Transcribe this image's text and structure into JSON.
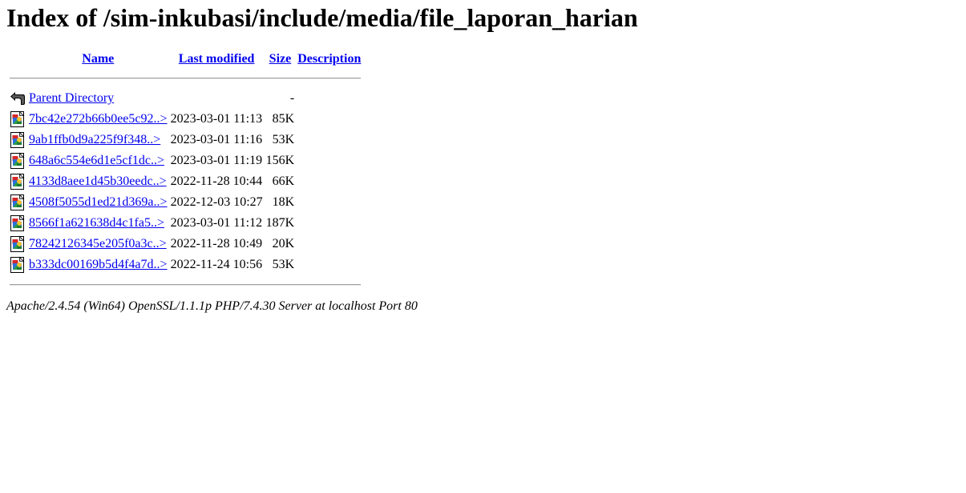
{
  "page": {
    "heading": "Index of /sim-inkubasi/include/media/file_laporan_harian"
  },
  "table": {
    "columns": {
      "name": "Name",
      "modified": "Last modified",
      "size": "Size",
      "description": "Description"
    },
    "parent": {
      "icon": "back-arrow-icon",
      "label": "Parent Directory",
      "size": "-"
    },
    "rows": [
      {
        "icon": "image-file-icon",
        "name": "7bc42e272b66b0ee5c92..>",
        "modified": "2023-03-01 11:13",
        "size": "85K",
        "description": ""
      },
      {
        "icon": "image-file-icon",
        "name": "9ab1ffb0d9a225f9f348..>",
        "modified": "2023-03-01 11:16",
        "size": "53K",
        "description": ""
      },
      {
        "icon": "image-file-icon",
        "name": "648a6c554e6d1e5cf1dc..>",
        "modified": "2023-03-01 11:19",
        "size": "156K",
        "description": ""
      },
      {
        "icon": "image-file-icon",
        "name": "4133d8aee1d45b30eedc..>",
        "modified": "2022-11-28 10:44",
        "size": "66K",
        "description": ""
      },
      {
        "icon": "image-file-icon",
        "name": "4508f5055d1ed21d369a..>",
        "modified": "2022-12-03 10:27",
        "size": "18K",
        "description": ""
      },
      {
        "icon": "image-file-icon",
        "name": "8566f1a621638d4c1fa5..>",
        "modified": "2023-03-01 11:12",
        "size": "187K",
        "description": ""
      },
      {
        "icon": "image-file-icon",
        "name": "78242126345e205f0a3c..>",
        "modified": "2022-11-28 10:49",
        "size": "20K",
        "description": ""
      },
      {
        "icon": "image-file-icon",
        "name": "b333dc00169b5d4f4a7d..>",
        "modified": "2022-11-24 10:56",
        "size": "53K",
        "description": ""
      }
    ]
  },
  "footer": {
    "server": "Apache/2.4.54 (Win64) OpenSSL/1.1.1p PHP/7.4.30 Server at localhost Port 80"
  },
  "colors": {
    "link": "#0000ee",
    "text": "#000000",
    "rule": "#a0a0a0"
  }
}
